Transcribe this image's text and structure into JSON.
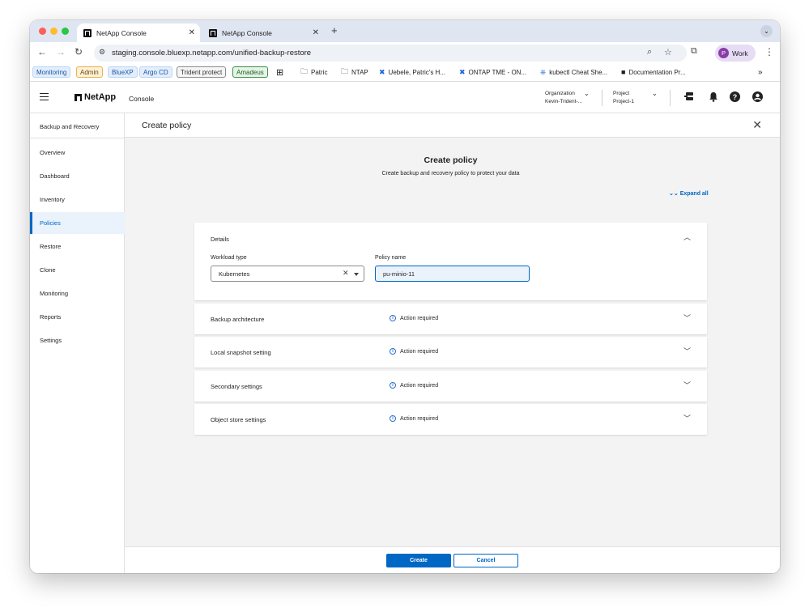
{
  "browser": {
    "tabs": [
      {
        "title": "NetApp Console",
        "active": true
      },
      {
        "title": "NetApp Console",
        "active": false
      }
    ],
    "new_tab": "+",
    "url": "staging.console.bluexp.netapp.com/unified-backup-restore",
    "profile_initial": "P",
    "profile_name": "Work",
    "bookmarks": [
      {
        "label": "Monitoring",
        "style": "blue-pill"
      },
      {
        "label": "Admin",
        "style": "orange-pill"
      },
      {
        "label": "BlueXP",
        "style": "blue-pill"
      },
      {
        "label": "Argo CD",
        "style": "blue-pill"
      },
      {
        "label": "Trident protect",
        "style": "gray-pill"
      },
      {
        "label": "Amadeus",
        "style": "green-pill"
      },
      {
        "label": "Patric",
        "icon": "folder-icon"
      },
      {
        "label": "NTAP",
        "icon": "folder-icon"
      },
      {
        "label": "Uebele, Patric's H...",
        "icon": "confluence-icon"
      },
      {
        "label": "ONTAP TME - ON...",
        "icon": "confluence-icon"
      },
      {
        "label": "kubectl Cheat She...",
        "icon": "kubernetes-icon"
      },
      {
        "label": "Documentation Pr...",
        "icon": "netapp-icon"
      }
    ],
    "more_bookmarks": "»"
  },
  "header": {
    "brand": "NetApp",
    "product": "Console",
    "organization_label": "Organization",
    "organization_value": "Kevin-Trident-...",
    "project_label": "Project",
    "project_value": "Project-1"
  },
  "sidebar": {
    "title": "Backup and Recovery",
    "items": [
      {
        "label": "Overview",
        "active": false
      },
      {
        "label": "Dashboard",
        "active": false
      },
      {
        "label": "Inventory",
        "active": false
      },
      {
        "label": "Policies",
        "active": true
      },
      {
        "label": "Restore",
        "active": false
      },
      {
        "label": "Clone",
        "active": false
      },
      {
        "label": "Monitoring",
        "active": false
      },
      {
        "label": "Reports",
        "active": false
      },
      {
        "label": "Settings",
        "active": false
      }
    ]
  },
  "main": {
    "title": "Create policy",
    "form_title": "Create policy",
    "form_subtitle": "Create backup and recovery policy to protect your data",
    "expand_all": "Expand all",
    "details": {
      "label": "Details",
      "workload_type_label": "Workload type",
      "workload_type_value": "Kubernetes",
      "policy_name_label": "Policy name",
      "policy_name_value": "pu-minio-11"
    },
    "sections": [
      {
        "label": "Backup architecture",
        "status": "Action required"
      },
      {
        "label": "Local snapshot setting",
        "status": "Action required"
      },
      {
        "label": "Secondary settings",
        "status": "Action required"
      },
      {
        "label": "Object store settings",
        "status": "Action required"
      }
    ]
  },
  "footer": {
    "create_label": "Create",
    "cancel_label": "Cancel"
  },
  "colors": {
    "primary": "#0067c5",
    "tabstrip": "#dfe6f2",
    "page_bg": "#f3f3f3"
  }
}
